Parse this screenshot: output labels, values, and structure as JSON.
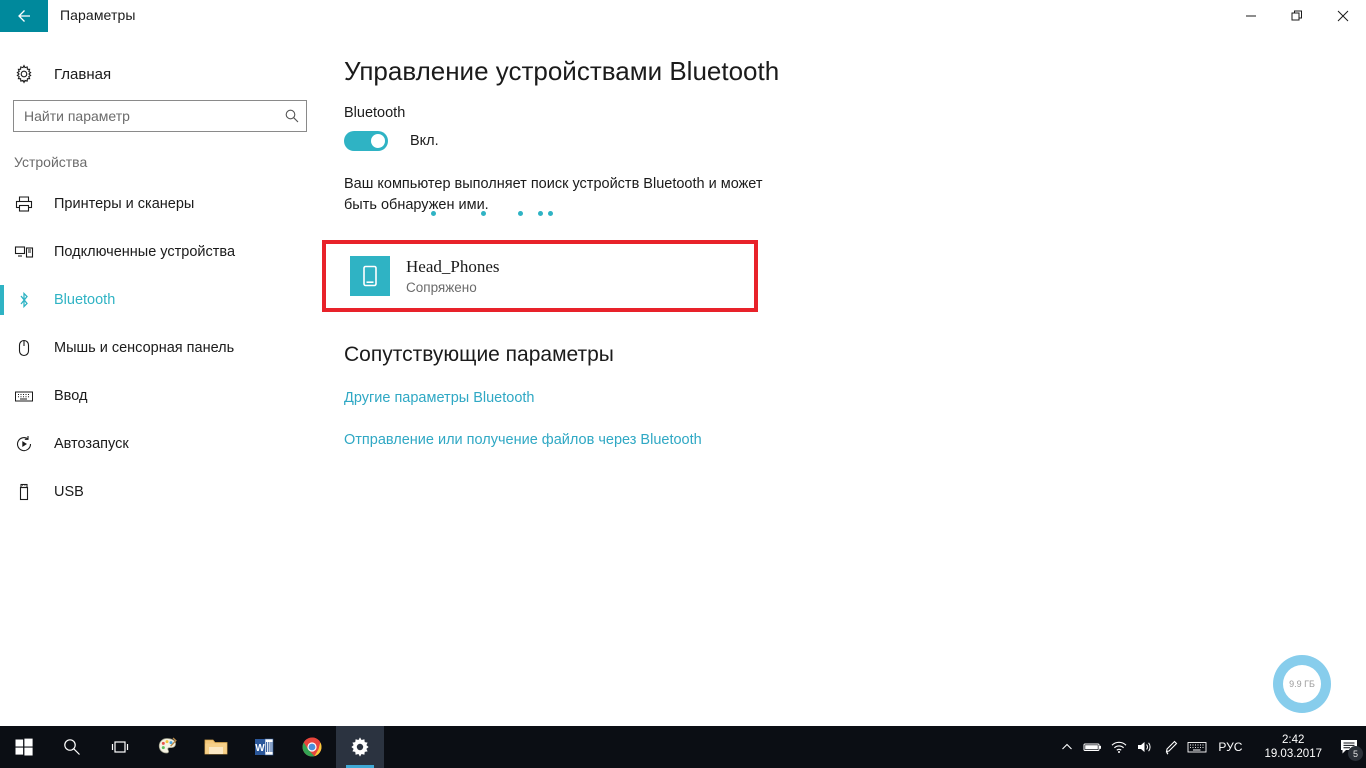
{
  "window": {
    "title": "Параметры",
    "back_icon": "back-arrow-icon",
    "minimize_label": "—",
    "maximize_label": "❐",
    "close_label": "✕"
  },
  "sidebar": {
    "home": {
      "label": "Главная",
      "icon": "gear-icon"
    },
    "search": {
      "value": "",
      "placeholder": "Найти параметр",
      "icon": "search-icon"
    },
    "group_title": "Устройства",
    "items": [
      {
        "label": "Принтеры и сканеры",
        "icon": "printer-icon",
        "selected": false
      },
      {
        "label": "Подключенные устройства",
        "icon": "connected-devices-icon",
        "selected": false
      },
      {
        "label": "Bluetooth",
        "icon": "bluetooth-icon",
        "selected": true
      },
      {
        "label": "Мышь и сенсорная панель",
        "icon": "mouse-icon",
        "selected": false
      },
      {
        "label": "Ввод",
        "icon": "keyboard-icon",
        "selected": false
      },
      {
        "label": "Автозапуск",
        "icon": "autoplay-icon",
        "selected": false
      },
      {
        "label": "USB",
        "icon": "usb-icon",
        "selected": false
      }
    ]
  },
  "main": {
    "page_title": "Управление устройствами Bluetooth",
    "bluetooth_label": "Bluetooth",
    "toggle_state": "Вкл.",
    "description": "Ваш компьютер выполняет поиск устройств Bluetooth и может быть обнаружен ими.",
    "device": {
      "name": "Head_Phones",
      "status": "Сопряжено",
      "icon": "phone-device-icon"
    },
    "related_title": "Сопутствующие параметры",
    "links": [
      "Другие параметры Bluetooth",
      "Отправление или получение файлов через Bluetooth"
    ]
  },
  "disk_gauge": {
    "value": "9.9 ГБ"
  },
  "taskbar": {
    "items": [
      {
        "name": "start-button",
        "icon": "windows-logo-icon",
        "running": false
      },
      {
        "name": "search-button",
        "icon": "search-icon",
        "running": false
      },
      {
        "name": "task-view-button",
        "icon": "task-view-icon",
        "running": false
      },
      {
        "name": "paint-app",
        "icon": "paint-icon",
        "running": true
      },
      {
        "name": "file-explorer-app",
        "icon": "folder-icon",
        "running": true
      },
      {
        "name": "word-app",
        "icon": "word-icon",
        "running": true
      },
      {
        "name": "chrome-app",
        "icon": "chrome-icon",
        "running": true
      },
      {
        "name": "settings-app",
        "icon": "gear-icon",
        "running": true,
        "active": true
      }
    ],
    "tray": {
      "language": "РУС",
      "time": "2:42",
      "date": "19.03.2017",
      "notification_count": "5"
    }
  },
  "colors": {
    "accent_teal": "#2fb3c4",
    "titlebar_teal": "#00899c",
    "highlight_red": "#e8222a",
    "link_teal": "#2fa8c4",
    "gauge_blue": "#87cdec"
  }
}
